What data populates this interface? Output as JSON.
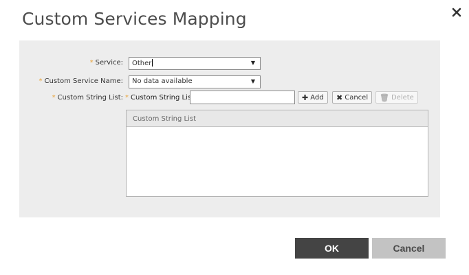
{
  "dialog": {
    "title": "Custom Services Mapping",
    "close_icon": "close-icon"
  },
  "form": {
    "required_mark": "*",
    "service": {
      "label": "Service:",
      "value": "Other"
    },
    "custom_service_name": {
      "label": "Custom Service Name:",
      "value": "No data available"
    },
    "custom_string_list": {
      "label": "Custom String List:",
      "input_label": "Custom String List",
      "input_value": "",
      "add_label": "Add",
      "cancel_label": "Cancel",
      "delete_label": "Delete",
      "table_header": "Custom String List",
      "rows": []
    }
  },
  "footer": {
    "ok_label": "OK",
    "cancel_label": "Cancel"
  },
  "colors": {
    "required": "#e8a33b",
    "panel_bg": "#ededed",
    "ok_bg": "#444444",
    "cancel_bg": "#c3c3c3"
  }
}
